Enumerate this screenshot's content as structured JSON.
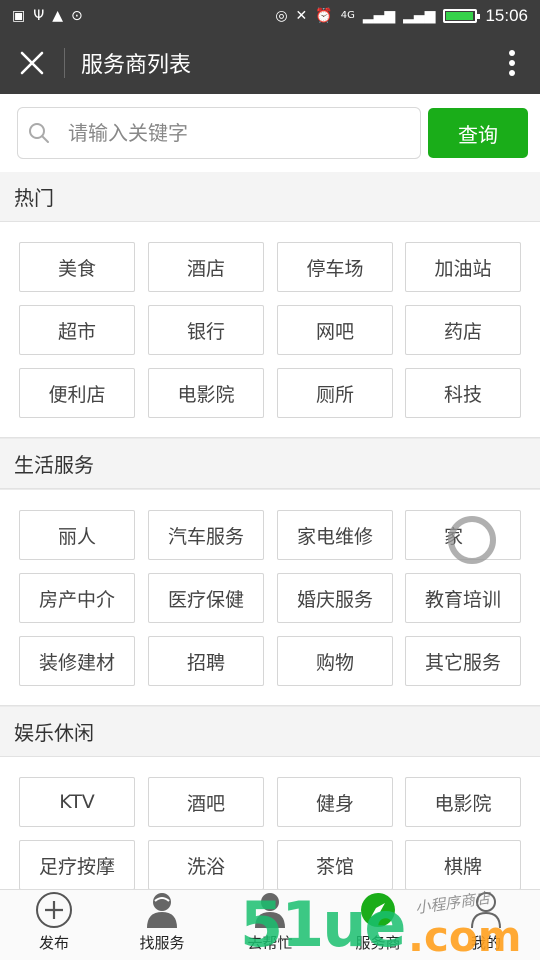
{
  "status_bar": {
    "left_icons": [
      "image-icon",
      "usb-icon",
      "warning-icon",
      "more-dots-icon"
    ],
    "right_icons": [
      "nfc-icon",
      "mute-icon",
      "alarm-icon",
      "signal-4g-icon",
      "wifi-signal-icon",
      "battery-icon"
    ],
    "network_label": "4G",
    "battery_level": 0.95,
    "battery_color": "#36d24b",
    "time": "15:06"
  },
  "titlebar": {
    "title": "服务商列表",
    "background": "#3d3d3d"
  },
  "search": {
    "placeholder": "请输入关键字",
    "value": "",
    "button_label": "查询",
    "button_color": "#1aad19"
  },
  "sections": [
    {
      "title": "热门",
      "tags": [
        "美食",
        "酒店",
        "停车场",
        "加油站",
        "超市",
        "银行",
        "网吧",
        "药店",
        "便利店",
        "电影院",
        "厕所",
        "科技"
      ]
    },
    {
      "title": "生活服务",
      "tags": [
        "丽人",
        "汽车服务",
        "家电维修",
        "家",
        "房产中介",
        "医疗保健",
        "婚庆服务",
        "教育培训",
        "装修建材",
        "招聘",
        "购物",
        "其它服务"
      ]
    },
    {
      "title": "娱乐休闲",
      "tags": [
        "KTV",
        "酒吧",
        "健身",
        "电影院",
        "足疗按摩",
        "洗浴",
        "茶馆",
        "棋牌"
      ]
    }
  ],
  "tabbar": {
    "items": [
      {
        "label": "发布",
        "icon": "plus-circle-icon"
      },
      {
        "label": "找服务",
        "icon": "person-icon"
      },
      {
        "label": "去帮忙",
        "icon": "person-icon"
      },
      {
        "label": "服务商",
        "icon": "compass-icon"
      },
      {
        "label": "我的",
        "icon": "person-icon"
      }
    ]
  },
  "watermark": {
    "main": "51ue",
    "suffix": ".com",
    "cn_text": "小程序商店"
  }
}
